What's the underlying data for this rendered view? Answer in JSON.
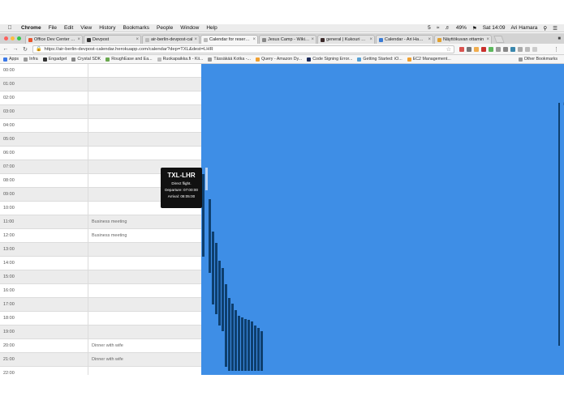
{
  "menubar": {
    "items": [
      "Chrome",
      "File",
      "Edit",
      "View",
      "History",
      "Bookmarks",
      "People",
      "Window",
      "Help"
    ],
    "status": [
      "5",
      "49%",
      "Sat 14:09",
      "Ari Hamara"
    ]
  },
  "tabs": [
    {
      "label": "Office Dev Center - Of",
      "color": "#e8532b",
      "active": false
    },
    {
      "label": "Devpost",
      "color": "#333333",
      "active": false
    },
    {
      "label": "air-berlin-devpost-cal",
      "color": "#bbbbbb",
      "active": false
    },
    {
      "label": "Calendar for reservatio",
      "color": "#bbbbbb",
      "active": true
    },
    {
      "label": "Jesus Camp - Wikipedi",
      "color": "#888888",
      "active": false
    },
    {
      "label": "general | Kukouri Black",
      "color": "#3b2a2a",
      "active": false
    },
    {
      "label": "Calendar - Ari Hamara",
      "color": "#3a7bd5",
      "active": false
    },
    {
      "label": "Näyttökuvan ottamin",
      "color": "#e0a030",
      "active": false
    }
  ],
  "address": {
    "url": "https://air-berlin-devpost-calendar.herokuapp.com/calendar?dep=TXL&dest=LHR"
  },
  "bookmarks": [
    {
      "label": "Apps",
      "color": "#3b78e7"
    },
    {
      "label": "Infra",
      "color": "#9a9a9a"
    },
    {
      "label": "Engadget",
      "color": "#333333"
    },
    {
      "label": "Crystal SDK",
      "color": "#888888"
    },
    {
      "label": "RoughEase and Ea...",
      "color": "#6aa84f"
    },
    {
      "label": "Ruokapaikka.fi - Kii...",
      "color": "#bbbbbb"
    },
    {
      "label": "Tässäkää Kotka -...",
      "color": "#999999"
    },
    {
      "label": "Query - Amazon Dy...",
      "color": "#f0a030"
    },
    {
      "label": "Code Signing Error...",
      "color": "#1c2b5a"
    },
    {
      "label": "Getting Started: iO...",
      "color": "#56a0d3"
    },
    {
      "label": "EC2 Management...",
      "color": "#f0a030"
    }
  ],
  "bookmarks_other": "Other Bookmarks",
  "timeline": [
    {
      "hour": "00:00",
      "event": ""
    },
    {
      "hour": "01:00",
      "event": ""
    },
    {
      "hour": "02:00",
      "event": ""
    },
    {
      "hour": "03:00",
      "event": ""
    },
    {
      "hour": "04:00",
      "event": ""
    },
    {
      "hour": "05:00",
      "event": ""
    },
    {
      "hour": "06:00",
      "event": ""
    },
    {
      "hour": "07:00",
      "event": ""
    },
    {
      "hour": "08:00",
      "event": ""
    },
    {
      "hour": "09:00",
      "event": ""
    },
    {
      "hour": "10:00",
      "event": ""
    },
    {
      "hour": "11:00",
      "event": "Business meeting"
    },
    {
      "hour": "12:00",
      "event": "Business meeting"
    },
    {
      "hour": "13:00",
      "event": ""
    },
    {
      "hour": "14:00",
      "event": ""
    },
    {
      "hour": "15:00",
      "event": ""
    },
    {
      "hour": "16:00",
      "event": ""
    },
    {
      "hour": "17:00",
      "event": ""
    },
    {
      "hour": "18:00",
      "event": ""
    },
    {
      "hour": "19:00",
      "event": ""
    },
    {
      "hour": "20:00",
      "event": "Dinner with wife"
    },
    {
      "hour": "21:00",
      "event": "Dinner with wife"
    },
    {
      "hour": "22:00",
      "event": ""
    }
  ],
  "flights": [
    {
      "start": 8.0,
      "end": 14.0,
      "highlight": false
    },
    {
      "start": 7.5,
      "end": 9.2,
      "highlight": true
    },
    {
      "start": 9.8,
      "end": 15.2,
      "highlight": false
    },
    {
      "start": 12.2,
      "end": 17.5,
      "highlight": false
    },
    {
      "start": 13.0,
      "end": 18.2,
      "highlight": false
    },
    {
      "start": 14.3,
      "end": 19.0,
      "highlight": false
    },
    {
      "start": 14.8,
      "end": 19.4,
      "highlight": false
    },
    {
      "start": 16.0,
      "end": 22.0,
      "highlight": false
    },
    {
      "start": 17.0,
      "end": 22.3,
      "highlight": false
    },
    {
      "start": 17.4,
      "end": 22.3,
      "highlight": false
    },
    {
      "start": 17.9,
      "end": 22.3,
      "highlight": false
    },
    {
      "start": 18.3,
      "end": 22.3,
      "highlight": false
    },
    {
      "start": 18.4,
      "end": 22.3,
      "highlight": false
    },
    {
      "start": 18.5,
      "end": 22.3,
      "highlight": false
    },
    {
      "start": 18.6,
      "end": 22.3,
      "highlight": false
    },
    {
      "start": 18.7,
      "end": 22.3,
      "highlight": false
    },
    {
      "start": 19.0,
      "end": 22.3,
      "highlight": false
    },
    {
      "start": 19.2,
      "end": 22.3,
      "highlight": false
    },
    {
      "start": 19.4,
      "end": 22.3,
      "highlight": false
    }
  ],
  "tooltip": {
    "title": "TXL-LHR",
    "type": "Direct flight.",
    "departure": "Departure: 07:00:00",
    "arrival": "Arrival: 08:05:00"
  },
  "colors": {
    "panel": "#3e8ee6",
    "bar": "#0e3f6e",
    "highlight": "#b8d2f2"
  }
}
